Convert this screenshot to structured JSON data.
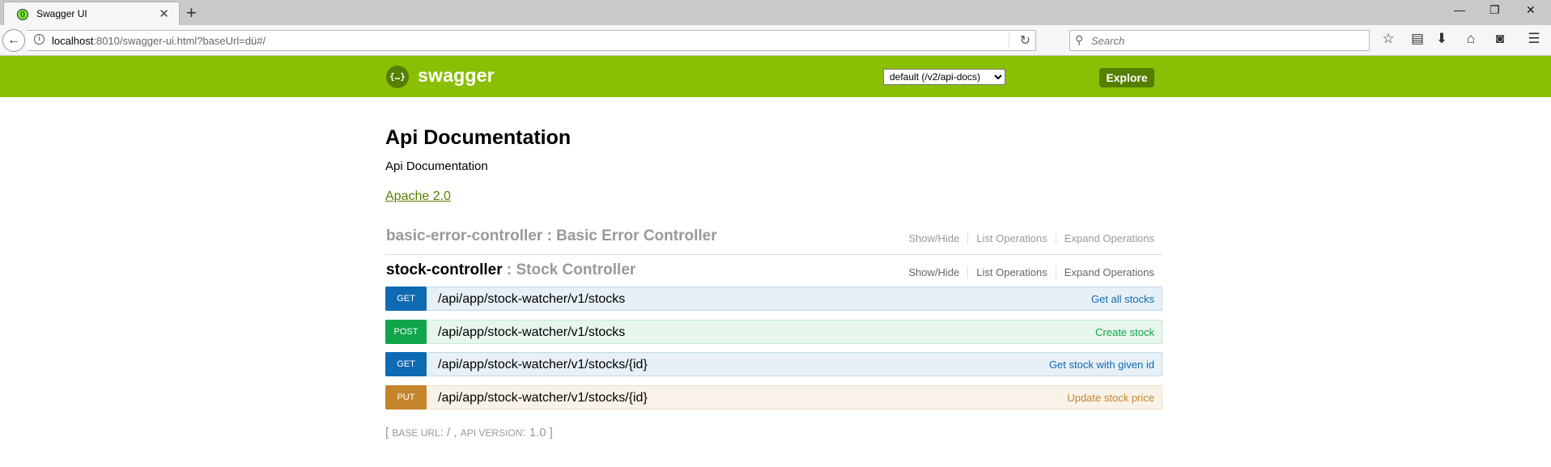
{
  "browser": {
    "tab_title": "Swagger UI",
    "url_host": "localhost",
    "url_rest": ":8010/swagger-ui.html?baseUrl=dü#/",
    "search_placeholder": "Search"
  },
  "swagger_header": {
    "logo_glyph": "{…}",
    "brand": "swagger",
    "spec_select": "default (/v2/api-docs)",
    "explore_label": "Explore",
    "brand_color": "#89bf04"
  },
  "api": {
    "title": "Api Documentation",
    "description": "Api Documentation",
    "license": "Apache 2.0"
  },
  "resources": [
    {
      "id": "basic-error-controller",
      "desc": " : Basic Error Controller",
      "actions": [
        "Show/Hide",
        "List Operations",
        "Expand Operations"
      ]
    },
    {
      "id": "stock-controller",
      "desc": " : Stock Controller",
      "actions": [
        "Show/Hide",
        "List Operations",
        "Expand Operations"
      ]
    }
  ],
  "operations": [
    {
      "method": "GET",
      "path": "/api/app/stock-watcher/v1/stocks",
      "summary": "Get all stocks",
      "color": "#0f6ab4"
    },
    {
      "method": "POST",
      "path": "/api/app/stock-watcher/v1/stocks",
      "summary": "Create stock",
      "color": "#10a54a"
    },
    {
      "method": "GET",
      "path": "/api/app/stock-watcher/v1/stocks/{id}",
      "summary": "Get stock with given id",
      "color": "#0f6ab4"
    },
    {
      "method": "PUT",
      "path": "/api/app/stock-watcher/v1/stocks/{id}",
      "summary": "Update stock price",
      "color": "#c5862b"
    }
  ],
  "footer": {
    "open_bracket": "[ ",
    "base_url_label": "BASE URL",
    "base_url_value": ": / , ",
    "api_version_label": "API VERSION",
    "api_version_value": ": 1.0 ]"
  },
  "icons": [
    "swagger-favicon-icon",
    "close-icon",
    "plus-icon",
    "minimize-icon",
    "restore-icon",
    "close-window-icon",
    "back-arrow-icon",
    "info-icon",
    "reload-icon",
    "search-icon",
    "star-icon",
    "reading-list-icon",
    "download-icon",
    "home-icon",
    "pocket-icon",
    "menu-icon"
  ]
}
